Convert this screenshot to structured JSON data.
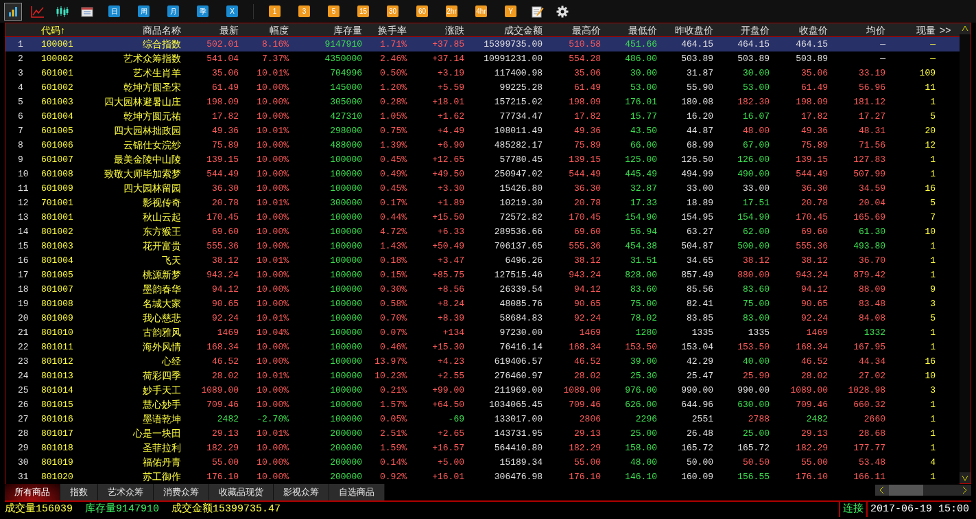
{
  "toolbar": [
    {
      "kind": "bars",
      "selected": true
    },
    {
      "kind": "line",
      "selected": false
    },
    {
      "kind": "candles",
      "selected": false
    },
    {
      "kind": "calendar",
      "selected": false
    },
    {
      "kind": "period",
      "label": "日",
      "selected": false
    },
    {
      "kind": "period",
      "label": "周",
      "selected": false
    },
    {
      "kind": "period",
      "label": "月",
      "selected": false
    },
    {
      "kind": "period",
      "label": "季",
      "selected": false
    },
    {
      "kind": "period",
      "label": "X",
      "selected": false
    },
    {
      "kind": "separator"
    },
    {
      "kind": "minute",
      "label": "1",
      "selected": false
    },
    {
      "kind": "minute",
      "label": "3",
      "selected": false
    },
    {
      "kind": "minute",
      "label": "5",
      "selected": false
    },
    {
      "kind": "minute",
      "label": "15",
      "selected": false
    },
    {
      "kind": "minute",
      "label": "30",
      "selected": false
    },
    {
      "kind": "minute",
      "label": "60",
      "selected": false
    },
    {
      "kind": "minute",
      "label": "2hr",
      "selected": false
    },
    {
      "kind": "minute",
      "label": "4hr",
      "selected": false
    },
    {
      "kind": "minute",
      "label": "Y",
      "selected": false
    },
    {
      "kind": "note",
      "selected": false
    },
    {
      "kind": "settings",
      "selected": false
    }
  ],
  "table": {
    "columns": [
      "",
      "代码↑",
      "商品名称",
      "最新",
      "幅度",
      "库存量",
      "换手率",
      "涨跌",
      "成交金额",
      "最高价",
      "最低价",
      "昨收盘价",
      "开盘价",
      "收盘价",
      "均价",
      "现量"
    ],
    "more": ">>",
    "rows": [
      {
        "selected": true,
        "cells": [
          "1",
          "100001",
          "综合指数",
          "502.01",
          "8.16%",
          "9147910",
          "1.71%",
          "+37.85",
          "15399735.00",
          "510.58",
          "451.66",
          "464.15",
          "464.15",
          "464.15",
          "—",
          "—"
        ]
      },
      {
        "selected": false,
        "cells": [
          "2",
          "100002",
          "艺术众筹指数",
          "541.04",
          "7.37%",
          "4350000",
          "2.46%",
          "+37.14",
          "10991231.00",
          "554.28",
          "486.00",
          "503.89",
          "503.89",
          "503.89",
          "—",
          "—"
        ]
      },
      {
        "selected": false,
        "cells": [
          "3",
          "601001",
          "艺术生肖羊",
          "35.06",
          "10.01%",
          "704996",
          "0.50%",
          "+3.19",
          "117400.98",
          "35.06",
          "30.00",
          "31.87",
          "30.00",
          "35.06",
          "33.19",
          "109"
        ]
      },
      {
        "selected": false,
        "cells": [
          "4",
          "601002",
          "乾坤方圆圣宋",
          "61.49",
          "10.00%",
          "145000",
          "1.20%",
          "+5.59",
          "99225.28",
          "61.49",
          "53.00",
          "55.90",
          "53.00",
          "61.49",
          "56.96",
          "11"
        ]
      },
      {
        "selected": false,
        "cells": [
          "5",
          "601003",
          "四大园林避暑山庄",
          "198.09",
          "10.00%",
          "305000",
          "0.28%",
          "+18.01",
          "157215.02",
          "198.09",
          "176.01",
          "180.08",
          "182.30",
          "198.09",
          "181.12",
          "1"
        ]
      },
      {
        "selected": false,
        "cells": [
          "6",
          "601004",
          "乾坤方圆元祐",
          "17.82",
          "10.00%",
          "427310",
          "1.05%",
          "+1.62",
          "77734.47",
          "17.82",
          "15.77",
          "16.20",
          "16.07",
          "17.82",
          "17.27",
          "5"
        ]
      },
      {
        "selected": false,
        "cells": [
          "7",
          "601005",
          "四大园林拙政园",
          "49.36",
          "10.01%",
          "298000",
          "0.75%",
          "+4.49",
          "108011.49",
          "49.36",
          "43.50",
          "44.87",
          "48.00",
          "49.36",
          "48.31",
          "20"
        ]
      },
      {
        "selected": false,
        "cells": [
          "8",
          "601006",
          "云锦仕女浣纱",
          "75.89",
          "10.00%",
          "488000",
          "1.39%",
          "+6.90",
          "485282.17",
          "75.89",
          "66.00",
          "68.99",
          "67.00",
          "75.89",
          "71.56",
          "12"
        ]
      },
      {
        "selected": false,
        "cells": [
          "9",
          "601007",
          "最美金陵中山陵",
          "139.15",
          "10.00%",
          "100000",
          "0.45%",
          "+12.65",
          "57780.45",
          "139.15",
          "125.00",
          "126.50",
          "126.00",
          "139.15",
          "127.83",
          "1"
        ]
      },
      {
        "selected": false,
        "cells": [
          "10",
          "601008",
          "致敬大师毕加索梦",
          "544.49",
          "10.00%",
          "100000",
          "0.49%",
          "+49.50",
          "250947.02",
          "544.49",
          "445.49",
          "494.99",
          "490.00",
          "544.49",
          "507.99",
          "1"
        ]
      },
      {
        "selected": false,
        "cells": [
          "11",
          "601009",
          "四大园林留园",
          "36.30",
          "10.00%",
          "100000",
          "0.45%",
          "+3.30",
          "15426.80",
          "36.30",
          "32.87",
          "33.00",
          "33.00",
          "36.30",
          "34.59",
          "16"
        ]
      },
      {
        "selected": false,
        "cells": [
          "12",
          "701001",
          "影视传奇",
          "20.78",
          "10.01%",
          "300000",
          "0.17%",
          "+1.89",
          "10219.30",
          "20.78",
          "17.33",
          "18.89",
          "17.51",
          "20.78",
          "20.04",
          "5"
        ]
      },
      {
        "selected": false,
        "cells": [
          "13",
          "801001",
          "秋山云起",
          "170.45",
          "10.00%",
          "100000",
          "0.44%",
          "+15.50",
          "72572.82",
          "170.45",
          "154.90",
          "154.95",
          "154.90",
          "170.45",
          "165.69",
          "7"
        ]
      },
      {
        "selected": false,
        "cells": [
          "14",
          "801002",
          "东方猴王",
          "69.60",
          "10.00%",
          "100000",
          "4.72%",
          "+6.33",
          "289536.66",
          "69.60",
          "56.94",
          "63.27",
          "62.00",
          "69.60",
          "61.30",
          "10"
        ]
      },
      {
        "selected": false,
        "cells": [
          "15",
          "801003",
          "花开富贵",
          "555.36",
          "10.00%",
          "100000",
          "1.43%",
          "+50.49",
          "706137.65",
          "555.36",
          "454.38",
          "504.87",
          "500.00",
          "555.36",
          "493.80",
          "1"
        ]
      },
      {
        "selected": false,
        "cells": [
          "16",
          "801004",
          "飞天",
          "38.12",
          "10.01%",
          "100000",
          "0.18%",
          "+3.47",
          "6496.26",
          "38.12",
          "31.51",
          "34.65",
          "38.12",
          "38.12",
          "36.70",
          "1"
        ]
      },
      {
        "selected": false,
        "cells": [
          "17",
          "801005",
          "桃源新梦",
          "943.24",
          "10.00%",
          "100000",
          "0.15%",
          "+85.75",
          "127515.46",
          "943.24",
          "828.00",
          "857.49",
          "880.00",
          "943.24",
          "879.42",
          "1"
        ]
      },
      {
        "selected": false,
        "cells": [
          "18",
          "801007",
          "墨韵春华",
          "94.12",
          "10.00%",
          "100000",
          "0.30%",
          "+8.56",
          "26339.54",
          "94.12",
          "83.60",
          "85.56",
          "83.60",
          "94.12",
          "88.09",
          "9"
        ]
      },
      {
        "selected": false,
        "cells": [
          "19",
          "801008",
          "名城大家",
          "90.65",
          "10.00%",
          "100000",
          "0.58%",
          "+8.24",
          "48085.76",
          "90.65",
          "75.00",
          "82.41",
          "75.00",
          "90.65",
          "83.48",
          "3"
        ]
      },
      {
        "selected": false,
        "cells": [
          "20",
          "801009",
          "我心慈悲",
          "92.24",
          "10.01%",
          "100000",
          "0.70%",
          "+8.39",
          "58684.83",
          "92.24",
          "78.02",
          "83.85",
          "83.00",
          "92.24",
          "84.08",
          "5"
        ]
      },
      {
        "selected": false,
        "cells": [
          "21",
          "801010",
          "古韵雅风",
          "1469",
          "10.04%",
          "100000",
          "0.07%",
          "+134",
          "97230.00",
          "1469",
          "1280",
          "1335",
          "1335",
          "1469",
          "1332",
          "1"
        ]
      },
      {
        "selected": false,
        "cells": [
          "22",
          "801011",
          "海外风情",
          "168.34",
          "10.00%",
          "100000",
          "0.46%",
          "+15.30",
          "76416.14",
          "168.34",
          "153.50",
          "153.04",
          "153.50",
          "168.34",
          "167.95",
          "1"
        ]
      },
      {
        "selected": false,
        "cells": [
          "23",
          "801012",
          "心经",
          "46.52",
          "10.00%",
          "100000",
          "13.97%",
          "+4.23",
          "619406.57",
          "46.52",
          "39.00",
          "42.29",
          "40.00",
          "46.52",
          "44.34",
          "16"
        ]
      },
      {
        "selected": false,
        "cells": [
          "24",
          "801013",
          "荷彩四季",
          "28.02",
          "10.01%",
          "100000",
          "10.23%",
          "+2.55",
          "276460.97",
          "28.02",
          "25.30",
          "25.47",
          "25.90",
          "28.02",
          "27.02",
          "10"
        ]
      },
      {
        "selected": false,
        "cells": [
          "25",
          "801014",
          "妙手天工",
          "1089.00",
          "10.00%",
          "100000",
          "0.21%",
          "+99.00",
          "211969.00",
          "1089.00",
          "976.00",
          "990.00",
          "990.00",
          "1089.00",
          "1028.98",
          "3"
        ]
      },
      {
        "selected": false,
        "cells": [
          "26",
          "801015",
          "慧心妙手",
          "709.46",
          "10.00%",
          "100000",
          "1.57%",
          "+64.50",
          "1034065.45",
          "709.46",
          "626.00",
          "644.96",
          "630.00",
          "709.46",
          "660.32",
          "1"
        ]
      },
      {
        "selected": false,
        "cells": [
          "27",
          "801016",
          "墨语乾坤",
          "2482",
          "-2.70%",
          "100000",
          "0.05%",
          "-69",
          "133017.00",
          "2806",
          "2296",
          "2551",
          "2788",
          "2482",
          "2660",
          "1"
        ]
      },
      {
        "selected": false,
        "cells": [
          "28",
          "801017",
          "心是一块田",
          "29.13",
          "10.01%",
          "200000",
          "2.51%",
          "+2.65",
          "143731.95",
          "29.13",
          "25.00",
          "26.48",
          "25.00",
          "29.13",
          "28.68",
          "1"
        ]
      },
      {
        "selected": false,
        "cells": [
          "29",
          "801018",
          "圣菲拉利",
          "182.29",
          "10.00%",
          "200000",
          "1.59%",
          "+16.57",
          "564410.80",
          "182.29",
          "158.00",
          "165.72",
          "165.72",
          "182.29",
          "177.77",
          "1"
        ]
      },
      {
        "selected": false,
        "cells": [
          "30",
          "801019",
          "福佑丹青",
          "55.00",
          "10.00%",
          "200000",
          "0.14%",
          "+5.00",
          "15189.34",
          "55.00",
          "48.00",
          "50.00",
          "50.50",
          "55.00",
          "53.48",
          "4"
        ]
      },
      {
        "selected": false,
        "cells": [
          "31",
          "801020",
          "苏工御作",
          "176.10",
          "10.00%",
          "200000",
          "0.92%",
          "+16.01",
          "306476.98",
          "176.10",
          "146.10",
          "160.09",
          "156.55",
          "176.10",
          "166.11",
          "1"
        ]
      }
    ]
  },
  "tabs": [
    {
      "label": "所有商品",
      "selected": true
    },
    {
      "label": "指数",
      "selected": false
    },
    {
      "label": "艺术众筹",
      "selected": false
    },
    {
      "label": "消费众筹",
      "selected": false
    },
    {
      "label": "收藏品现货",
      "selected": false
    },
    {
      "label": "影视众筹",
      "selected": false
    },
    {
      "label": "自选商品",
      "selected": false
    }
  ],
  "status_bar": {
    "volume": "成交量156039",
    "stock": "库存量9147910",
    "amount": "成交金额15399735.47",
    "connection": "连接",
    "datetime": "2017-06-19 15:00"
  }
}
